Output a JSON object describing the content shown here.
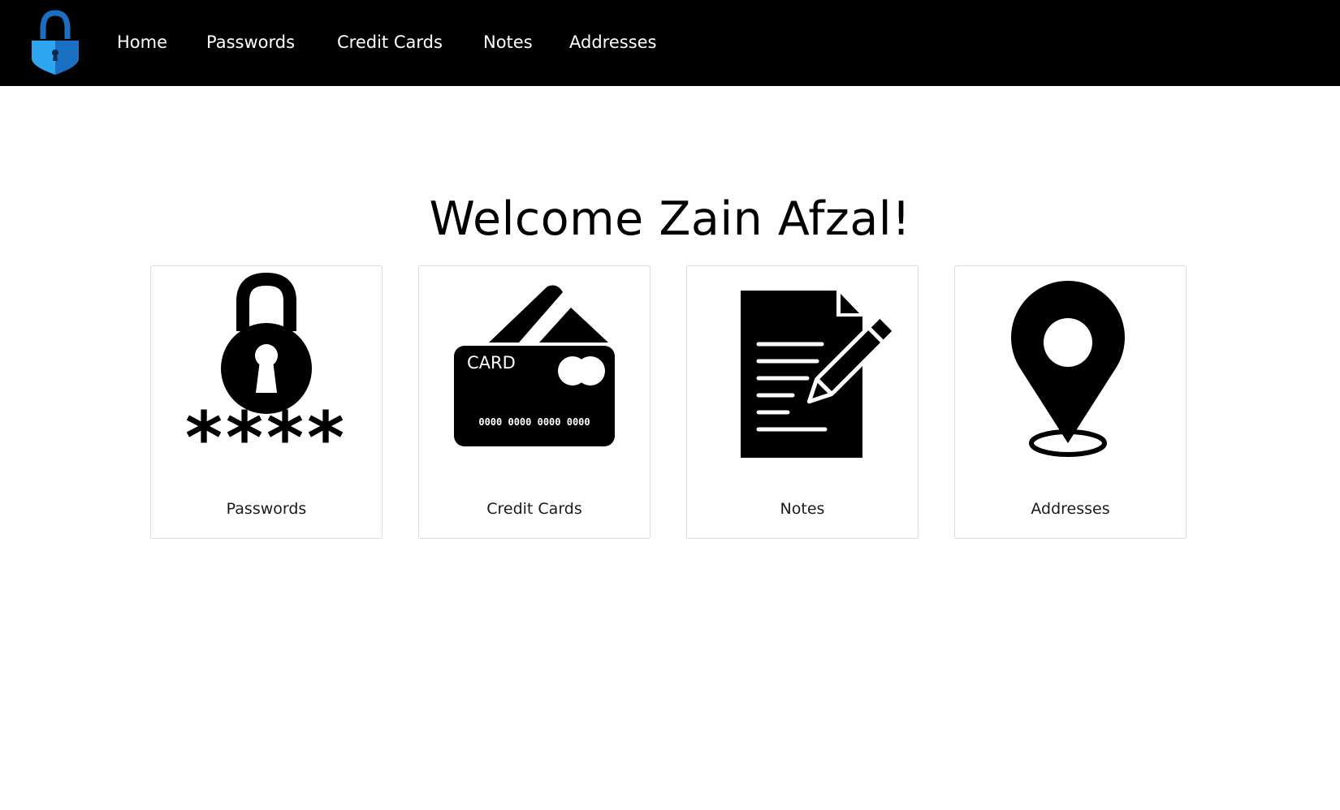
{
  "nav": {
    "logo_icon": "shield-lock-icon",
    "links": [
      "Home",
      "Passwords",
      "Credit Cards",
      "Notes",
      "Addresses"
    ]
  },
  "main": {
    "title": "Welcome Zain Afzal!",
    "cards": [
      {
        "label": "Passwords",
        "icon": "lock-password-icon",
        "mask": "****"
      },
      {
        "label": "Credit Cards",
        "icon": "credit-card-icon",
        "card_text": "CARD",
        "card_number": "0000 0000 0000 0000"
      },
      {
        "label": "Notes",
        "icon": "note-pencil-icon"
      },
      {
        "label": "Addresses",
        "icon": "map-pin-icon"
      }
    ]
  },
  "colors": {
    "navbar_bg": "#000000",
    "logo_light_blue": "#2ea6ef",
    "logo_dark_blue": "#1b6fc2"
  }
}
